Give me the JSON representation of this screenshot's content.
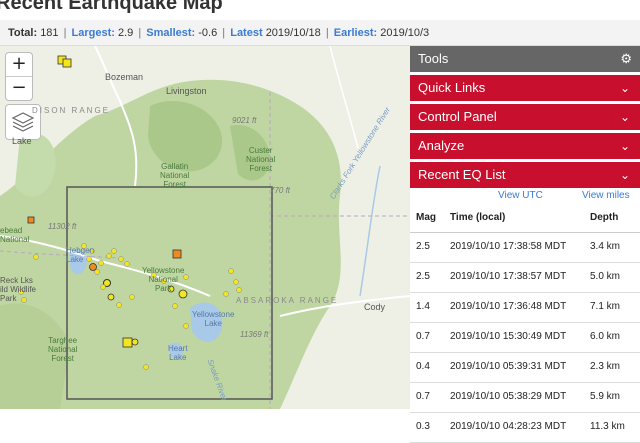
{
  "page": {
    "title": "Recent Earthquake Map"
  },
  "stats": {
    "total_label": "Total:",
    "total_value": "181",
    "largest_label": "Largest:",
    "largest_value": "2.9",
    "smallest_label": "Smallest:",
    "smallest_value": "-0.6",
    "latest_label": "Latest",
    "latest_value": "2019/10/18",
    "earliest_label": "Earliest:",
    "earliest_value": "2019/10/3",
    "separator": "|"
  },
  "map": {
    "zoom_in": "+",
    "zoom_out": "−",
    "places": {
      "bozeman": "Bozeman",
      "livingston": "Livingston",
      "madison_range": "DISON RANGE",
      "lake": "Lake",
      "hebgen_lake": "Hebgen\nLake",
      "west_yellowstone": "Yellowstone\nNational\nPark",
      "yellowstone_lake": "Yellowstone\nLake",
      "heart_lake": "Heart\nLake",
      "cody": "Cody",
      "gallatin": "Gallatin\nNational\nForest",
      "custer": "Custer\nNational\nForest",
      "targhee": "Targhee\nNational\nForest",
      "absaroka": "ABSAROKA RANGE",
      "reck_lks": "Reck Lks\nild Wildlife\nPark",
      "ebead": "ebead\nNational",
      "clarks_fork": "Clarks Fork Yellowstone River",
      "snake": "Snake River",
      "pk_9021": "9021 ft",
      "pk_770": "770 ft",
      "pk_11302": "11302 ft",
      "pk_11369": "11369 ft"
    },
    "colors": {
      "quake_yellow": "#f3e51e",
      "quake_orange": "#f08a1e",
      "quake_outline": "#333333",
      "forest": "#bfd6a2",
      "water": "#a9c9e8"
    }
  },
  "panel": {
    "tools": "Tools",
    "sections": [
      "Quick Links",
      "Control Panel",
      "Analyze",
      "Recent EQ List"
    ],
    "view_utc": "View UTC",
    "view_miles": "View miles",
    "columns": {
      "mag": "Mag",
      "time": "Time (local)",
      "depth": "Depth"
    },
    "rows": [
      {
        "mag": "2.5",
        "time": "2019/10/10 17:38:58 MDT",
        "depth": "3.4 km"
      },
      {
        "mag": "2.5",
        "time": "2019/10/10 17:38:57 MDT",
        "depth": "5.0 km"
      },
      {
        "mag": "1.4",
        "time": "2019/10/10 17:36:48 MDT",
        "depth": "7.1 km"
      },
      {
        "mag": "0.7",
        "time": "2019/10/10 15:30:49 MDT",
        "depth": "6.0 km"
      },
      {
        "mag": "0.4",
        "time": "2019/10/10 05:39:31 MDT",
        "depth": "2.3 km"
      },
      {
        "mag": "0.7",
        "time": "2019/10/10 05:38:29 MDT",
        "depth": "5.9 km"
      },
      {
        "mag": "0.3",
        "time": "2019/10/10 04:28:23 MDT",
        "depth": "11.3 km"
      }
    ]
  }
}
